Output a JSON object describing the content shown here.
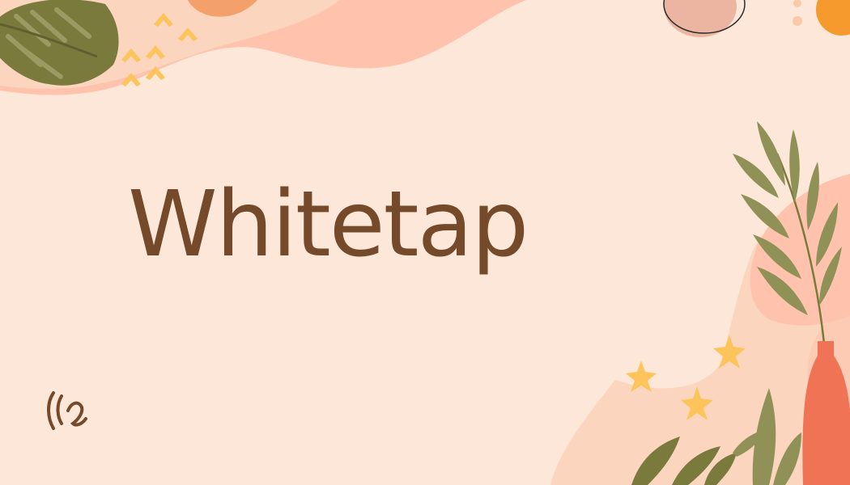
{
  "brand": {
    "name": "Whitetap",
    "text_color": "#744a2a"
  },
  "logo": {
    "icon": "whitetap-logo-mark-icon"
  },
  "palette": {
    "background": "#fde7d8",
    "blob_pink": "#ffc3ad",
    "blob_light": "#fbd5be",
    "leaf_olive": "#7a7a3d",
    "leaf_sage": "#9c9a63",
    "accent_yellow": "#fcc45b",
    "accent_orange": "#f79a2d",
    "vase_coral": "#f07355"
  },
  "decorations": [
    "monstera-leaf-icon",
    "chevron-pattern-icon",
    "palm-frond-icon",
    "vase-icon",
    "star-flower-icon",
    "circle-icon"
  ]
}
